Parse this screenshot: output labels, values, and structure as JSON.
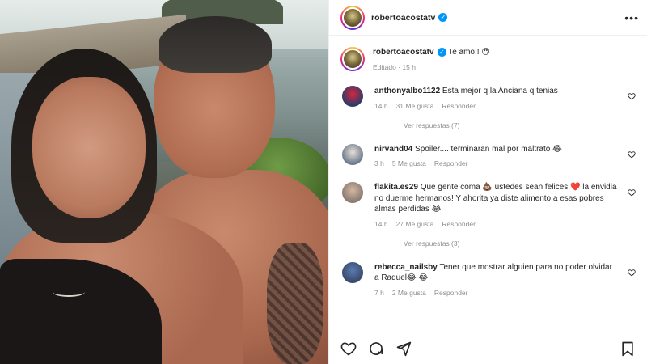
{
  "post": {
    "author": "robertoacostatv",
    "caption_text": "Te amo!! 😍",
    "caption_meta": "Editado · 15 h"
  },
  "comments": [
    {
      "user": "anthonyalbo1122",
      "text": "Esta mejor q la Anciana q tenias",
      "time": "14 h",
      "likes": "31 Me gusta",
      "reply": "Responder",
      "view_replies": "Ver respuestas (7)",
      "avatar_color": "#2a3c6b"
    },
    {
      "user": "nirvand04",
      "text": "Spoiler.... terminaran mal por maltrato 😂",
      "time": "3 h",
      "likes": "5 Me gusta",
      "reply": "Responder",
      "avatar_color": "#6b7a8c"
    },
    {
      "user": "flakita.es29",
      "text": "Que gente coma 💩 ustedes sean felices ❤️ la envidia no duerme hermanos! Y ahorita ya diste alimento a esas pobres almas perdidas 😂",
      "time": "14 h",
      "likes": "27 Me gusta",
      "reply": "Responder",
      "view_replies": "Ver respuestas (3)",
      "avatar_color": "#8a7a70"
    },
    {
      "user": "rebecca_nailsby",
      "text": "Tener que mostrar alguien para no poder olvidar a Raquel😂 😂",
      "time": "7 h",
      "likes": "2 Me gusta",
      "reply": "Responder",
      "avatar_color": "#3a4a6a"
    }
  ],
  "icons": {
    "verified": "verified-badge-icon",
    "more": "more-options-icon",
    "heart": "heart-icon",
    "comment": "comment-icon",
    "share": "share-icon",
    "save": "bookmark-icon"
  },
  "colors": {
    "verified_blue": "#0095f6",
    "meta_gray": "#8e8e8e",
    "text": "#262626"
  }
}
